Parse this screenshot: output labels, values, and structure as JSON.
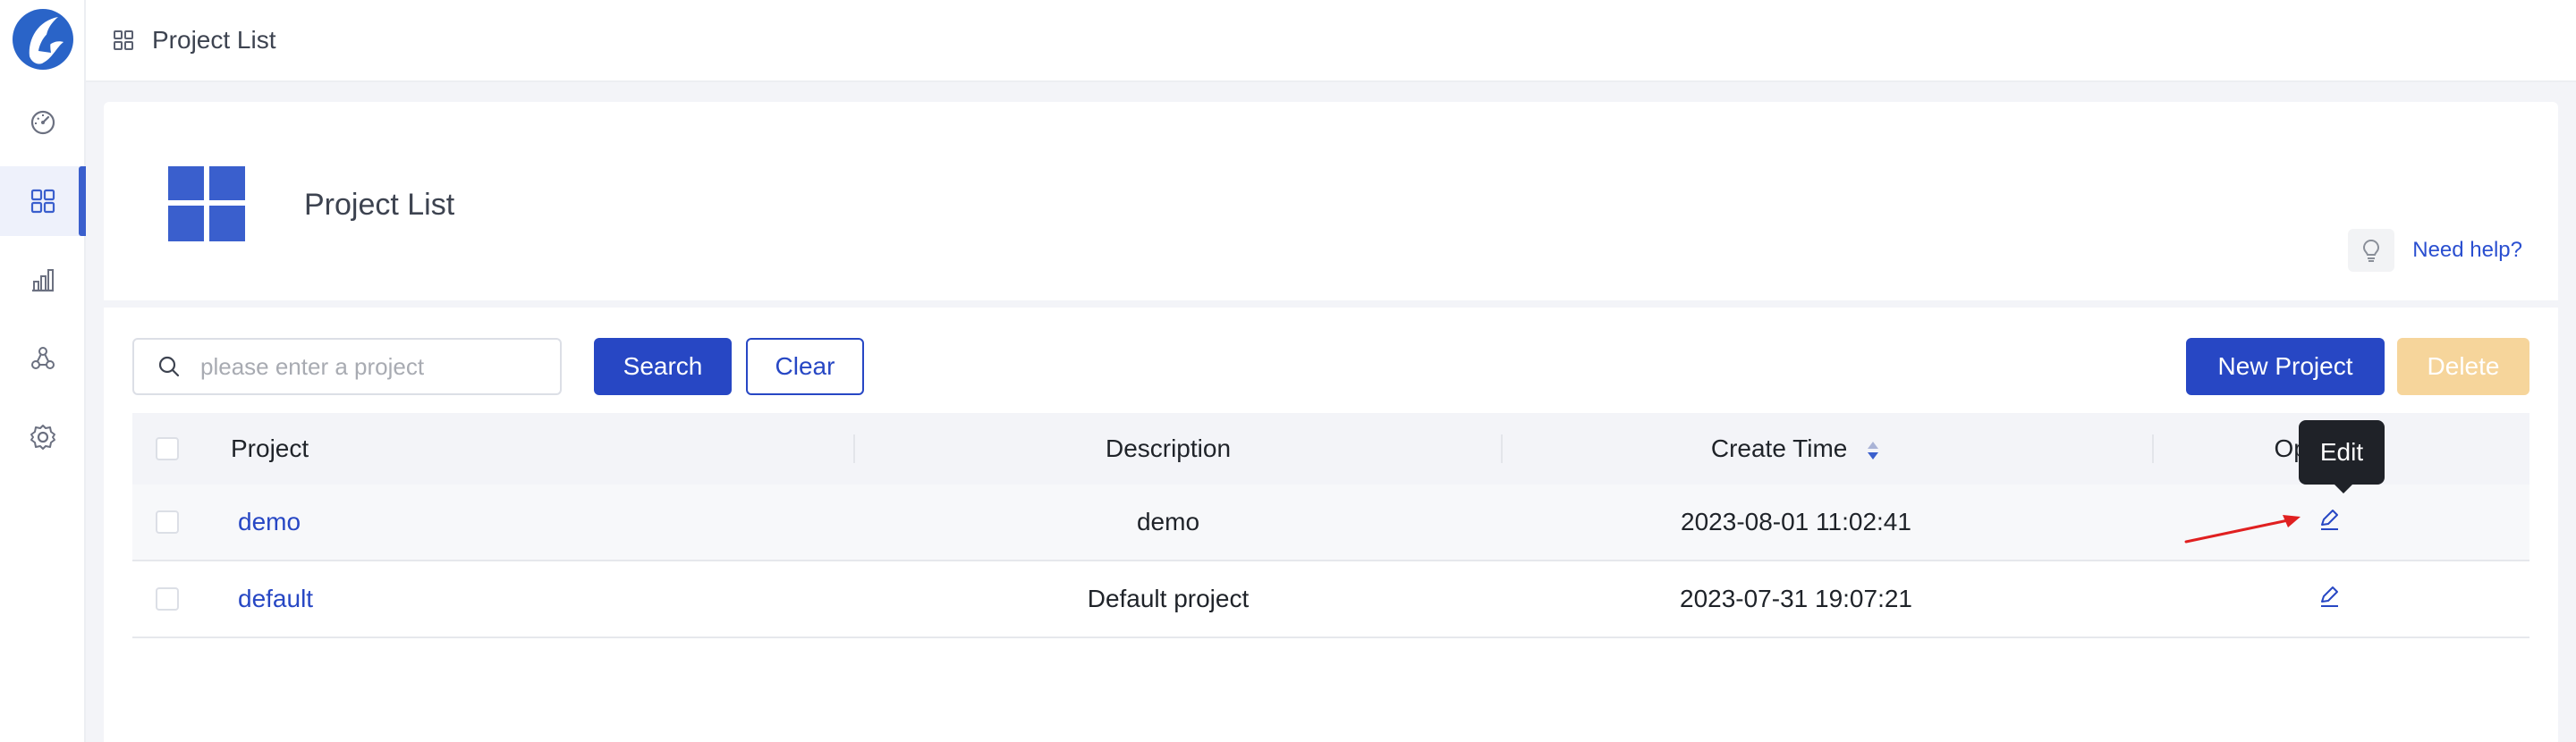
{
  "topbar": {
    "title": "Project List"
  },
  "sidebar": {
    "items": [
      {
        "icon": "dashboard-icon"
      },
      {
        "icon": "grid-icon",
        "active": true
      },
      {
        "icon": "bar-chart-icon"
      },
      {
        "icon": "cluster-icon"
      },
      {
        "icon": "gear-icon"
      }
    ]
  },
  "header": {
    "title": "Project List",
    "help_text": "Need help?"
  },
  "toolbar": {
    "search_placeholder": "please enter a project",
    "search_label": "Search",
    "clear_label": "Clear",
    "new_label": "New Project",
    "delete_label": "Delete"
  },
  "table": {
    "columns": {
      "project": "Project",
      "description": "Description",
      "create_time": "Create Time",
      "operation": "Operation"
    },
    "rows": [
      {
        "project": "demo",
        "description": "demo",
        "create_time": "2023-08-01 11:02:41"
      },
      {
        "project": "default",
        "description": "Default project",
        "create_time": "2023-07-31 19:07:21"
      }
    ]
  },
  "tooltip": {
    "text": "Edit"
  },
  "colors": {
    "primary": "#2747c4",
    "accent": "#3a5fcd",
    "delete_disabled": "#f6d59b",
    "annotation_arrow": "#e02020"
  }
}
